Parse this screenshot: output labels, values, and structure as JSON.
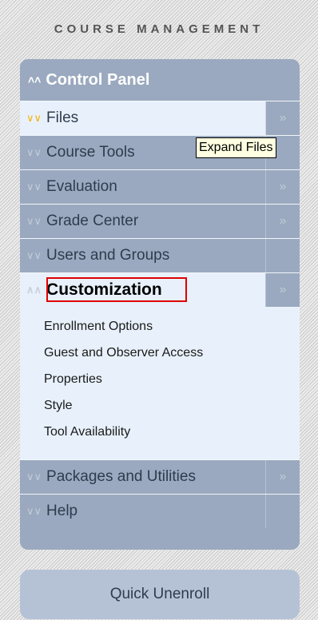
{
  "section_title": "COURSE MANAGEMENT",
  "control_panel": {
    "title": "Control Panel",
    "items": [
      {
        "label": "Files",
        "has_expand": true
      },
      {
        "label": "Course Tools",
        "has_expand": false
      },
      {
        "label": "Evaluation",
        "has_expand": true
      },
      {
        "label": "Grade Center",
        "has_expand": true
      },
      {
        "label": "Users and Groups",
        "has_expand": false
      },
      {
        "label": "Customization",
        "has_expand": true
      },
      {
        "label": "Packages and Utilities",
        "has_expand": true
      },
      {
        "label": "Help",
        "has_expand": false
      }
    ],
    "customization_submenu": [
      "Enrollment Options",
      "Guest and Observer Access",
      "Properties",
      "Style",
      "Tool Availability"
    ],
    "expand_glyph": "»",
    "collapsed_glyph": "≫",
    "collapse_glyph": "^"
  },
  "tooltip": {
    "text": "Expand Files"
  },
  "quick_unenroll": {
    "label": "Quick Unenroll"
  },
  "colors": {
    "panel_bg": "#9aa9bf",
    "active_bg": "#e8f1fb",
    "chevron_active": "#f2b300",
    "highlight_border": "#e00000",
    "tooltip_bg": "#ffffe1"
  }
}
